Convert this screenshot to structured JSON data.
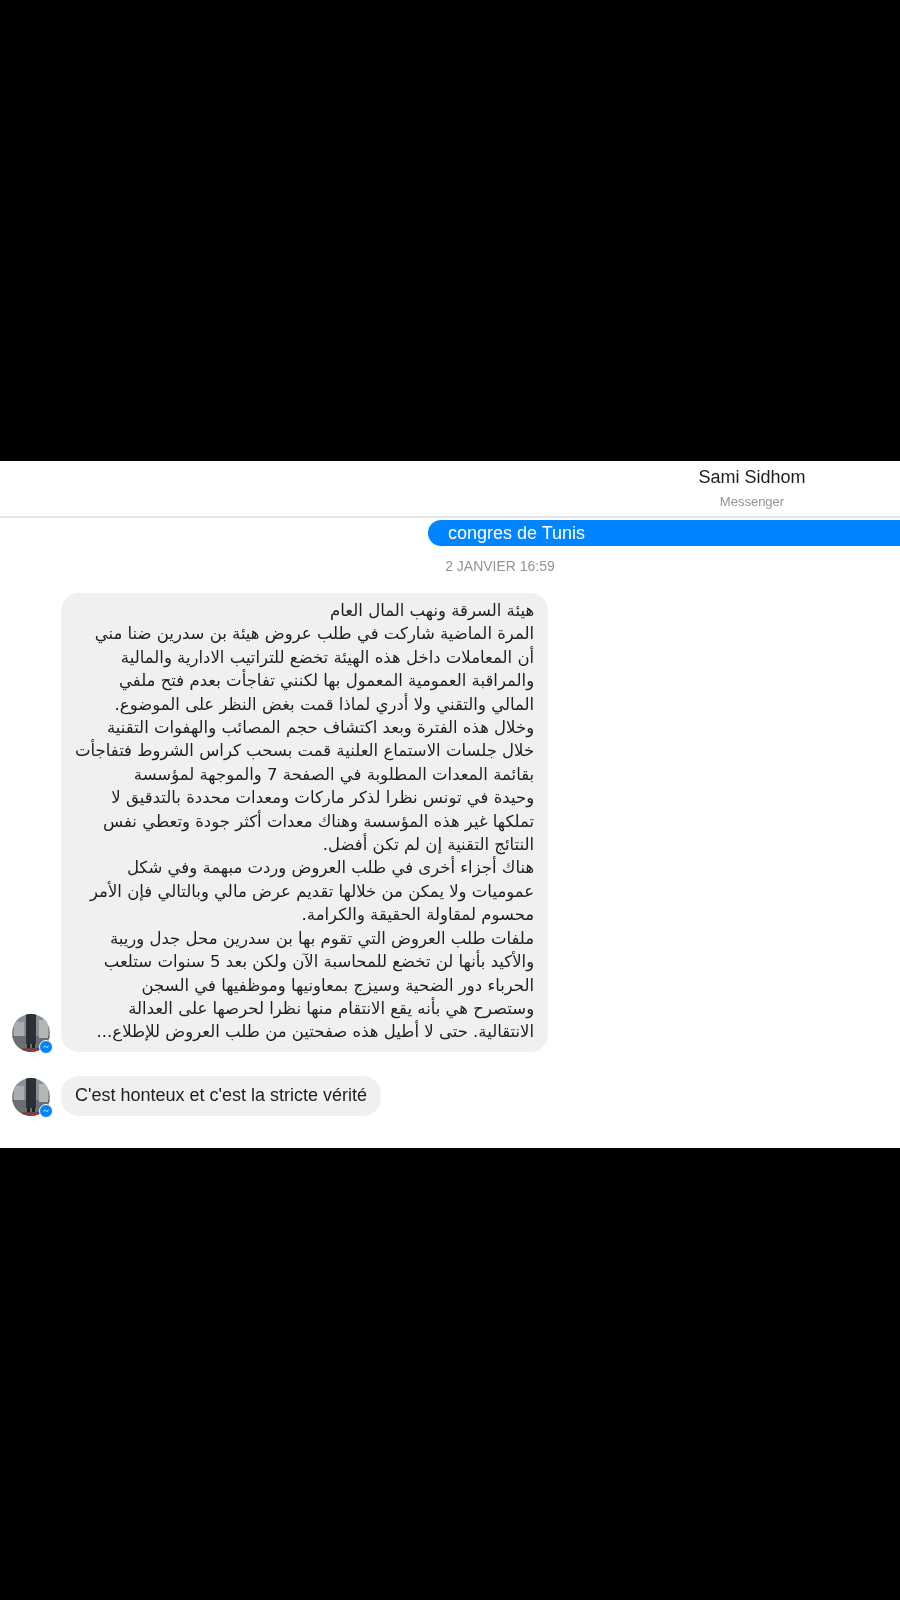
{
  "header": {
    "title": "Sami Sidhom",
    "subtitle": "Messenger"
  },
  "messages": [
    {
      "kind": "sent",
      "lines": [
        "congres de Tunis"
      ]
    },
    {
      "kind": "timestamp",
      "lines": [
        "2 JANVIER 16:59"
      ]
    },
    {
      "kind": "received",
      "lines": [
        "هيئة السرقة ونهب المال العام",
        "المرة الماضية شاركت في طلب عروض هيئة بن سدرين ضنا مني",
        "أن المعاملات داخل هذه الهيئة تخضع للتراتيب الادارية والمالية",
        "والمراقبة العمومية المعمول بها لكنني تفاجأت بعدم فتح ملفي",
        "المالي والتقني ولا أدري لماذا قمت بغض النظر على الموضوع.",
        "وخلال هذه الفترة وبعد اكتشاف حجم المصائب والهفوات التقنية",
        "خلال جلسات الاستماع العلنية قمت بسحب كراس الشروط فتفاجأت",
        "بقائمة المعدات المطلوبة في الصفحة 7 والموجهة لمؤسسة",
        "وحيدة في تونس نظرا لذكر ماركات ومعدات محددة بالتدقيق لا",
        "تملكها غير هذه المؤسسة وهناك معدات أكثر جودة وتعطي نفس",
        "النتائج التقنية إن لم تكن أفضل.",
        "هناك أجزاء أخرى في طلب العروض وردت مبهمة وفي شكل",
        "عموميات ولا يمكن من خلالها تقديم عرض مالي وبالتالي فإن الأمر",
        "محسوم لمقاولة الحقيقة والكرامة.",
        "ملفات طلب العروض التي تقوم بها بن سدرين محل جدل وريبة",
        "والأكيد بأنها لن تخضع للمحاسبة الآن ولكن بعد 5 سنوات ستلعب",
        "الحرباء دور الضحية وسيزج بمعاونيها وموظفيها في السجن",
        "وستصرح هي بأنه يقع الانتقام منها نظرا لحرصها على العدالة",
        "الانتقالية. حتى لا أطيل هذه صفحتين من طلب العروض للإطلاع..."
      ]
    },
    {
      "kind": "received",
      "lines": [
        "C'est honteux et c'est la stricte vérité"
      ]
    }
  ]
}
